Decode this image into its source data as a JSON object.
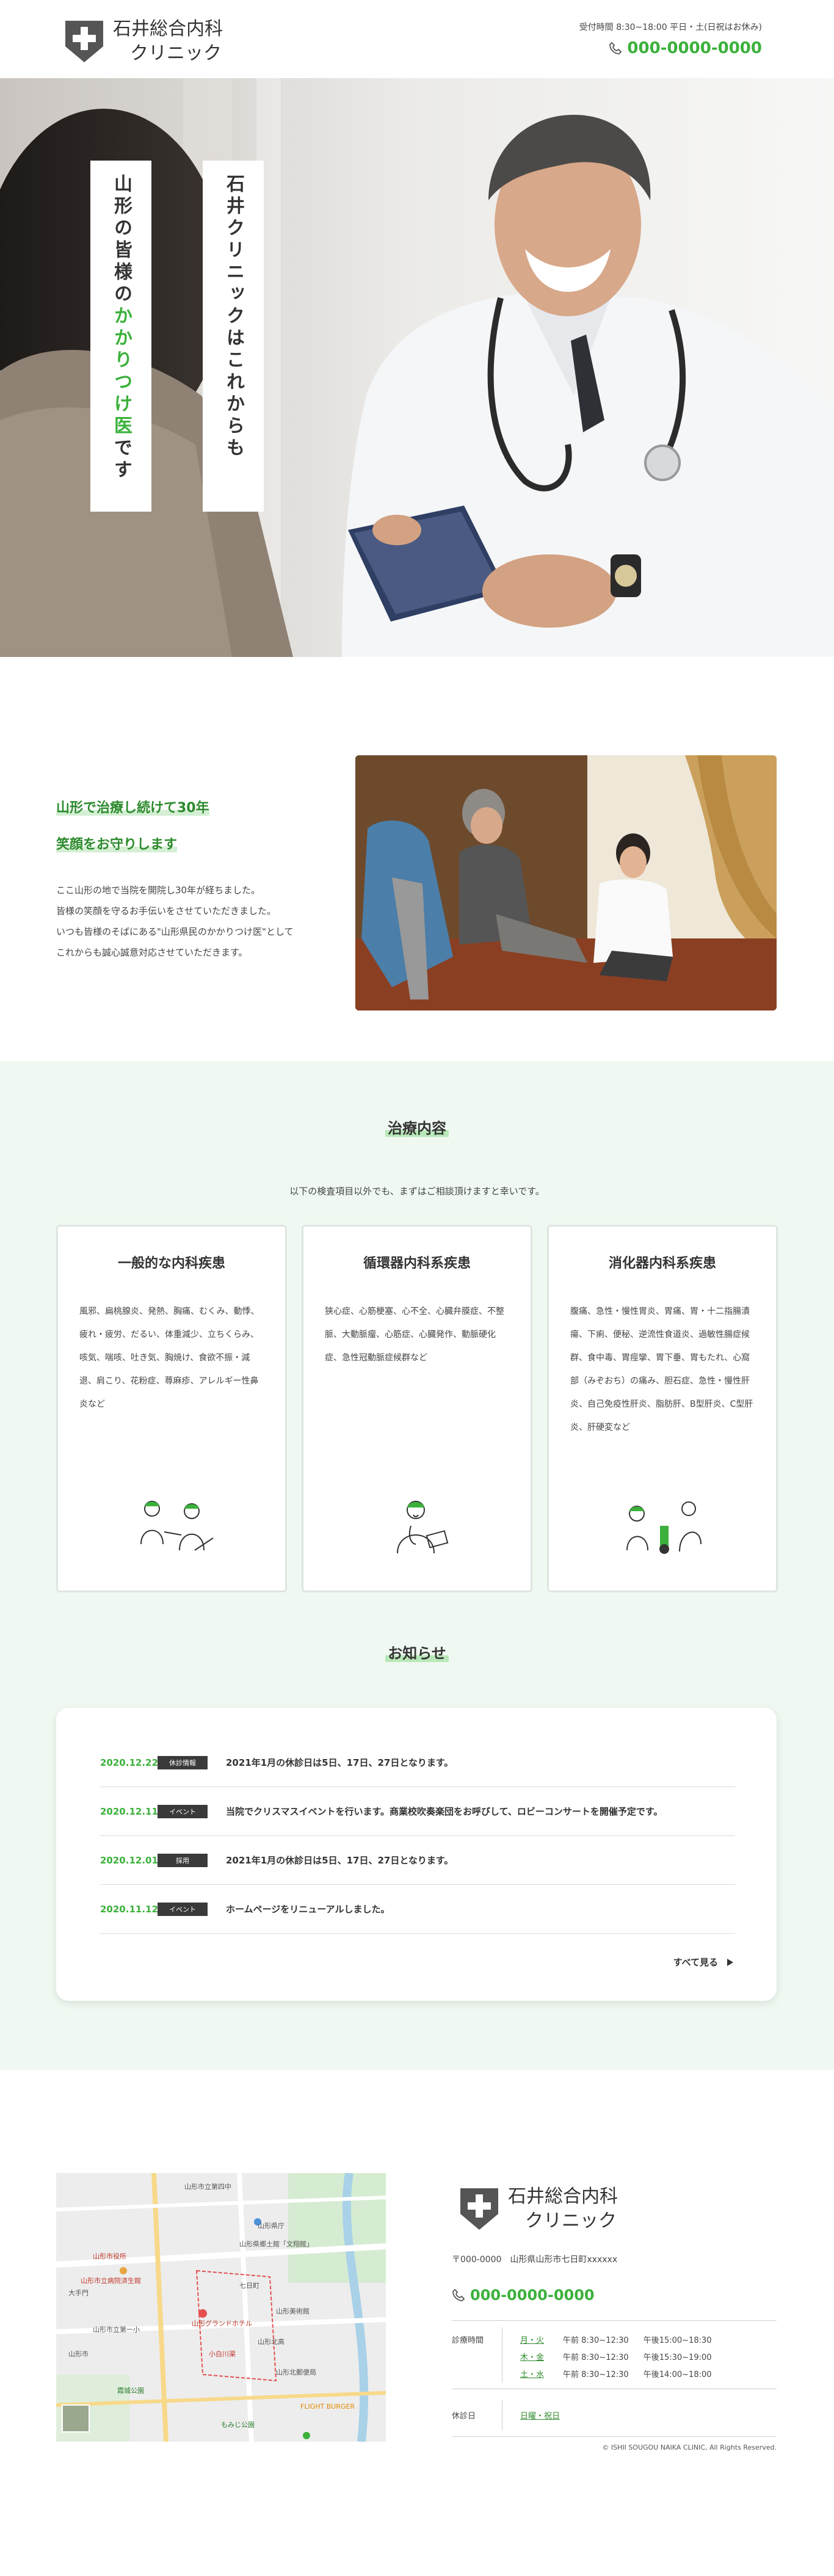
{
  "header": {
    "logo_line1": "石井総合内科",
    "logo_line2": "クリニック",
    "hours": "受付時間 8:30~18:00 平日・土(日祝はお休み)",
    "tel": "000-0000-0000"
  },
  "hero": {
    "vtext_right": "石井クリニックはこれからも",
    "vtext_left_pre": "山形の皆様の",
    "vtext_left_hl": "かかりつけ医",
    "vtext_left_post": "です"
  },
  "intro": {
    "title1": "山形で治療し続けて30年",
    "title2": "笑顔をお守りします",
    "lines": [
      "ここ山形の地で当院を開院し30年が経ちました。",
      "皆様の笑顔を守るお手伝いをさせていただきました。",
      "いつも皆様のそばにある\"山形県民のかかりつけ医\"として",
      "これからも誠心誠意対応させていただきます。"
    ]
  },
  "services": {
    "title": "治療内容",
    "subtitle": "以下の検査項目以外でも、まずはご相談頂けますと幸いです。",
    "cards": [
      {
        "title": "一般的な内科疾患",
        "text": "風邪、扁桃腺炎、発熱、胸痛、むくみ、動悸、疲れ・疲労、だるい、体重減少、立ちくらみ、咳気、喘咳、吐き気、胸焼け、食欲不振・減退、肩こり、花粉症、蕁麻疹、アレルギー性鼻炎など"
      },
      {
        "title": "循環器内科系疾患",
        "text": "狭心症、心筋梗塞、心不全、心臓弁膜症、不整脈、大動脈瘤、心筋症、心臓発作、動脈硬化症、急性冠動脈症候群など"
      },
      {
        "title": "消化器内科系疾患",
        "text": "腹痛、急性・慢性胃炎、胃痛、胃・十二指腸潰瘍、下痢、便秘、逆流性食道炎、過敏性腸症候群、食中毒、胃痙攣、胃下垂、胃もたれ、心窩部（みぞおち）の痛み、胆石症、急性・慢性肝炎、自己免疫性肝炎、脂肪肝、B型肝炎、C型肝炎、肝硬変など"
      }
    ]
  },
  "news": {
    "title": "お知らせ",
    "items": [
      {
        "date": "2020.12.22",
        "tag": "休診情報",
        "text": "2021年1月の休診日は5日、17日、27日となります。"
      },
      {
        "date": "2020.12.11",
        "tag": "イベント",
        "text": "当院でクリスマスイベントを行います。商業校吹奏楽団をお呼びして、ロビーコンサートを開催予定です。"
      },
      {
        "date": "2020.12.01",
        "tag": "採用",
        "text": "2021年1月の休診日は5日、17日、27日となります。"
      },
      {
        "date": "2020.11.12",
        "tag": "イベント",
        "text": "ホームページをリニューアルしました。"
      }
    ],
    "more": "すべて見る"
  },
  "footer": {
    "logo_line1": "石井総合内科",
    "logo_line2": "クリニック",
    "address": "〒000-0000　山形県山形市七日町xxxxxx",
    "tel": "000-0000-0000",
    "hours_label": "診療時間",
    "schedule": [
      {
        "day": "月・火",
        "am": "午前 8:30~12:30",
        "pm": "午後15:00~18:30"
      },
      {
        "day": "木・金",
        "am": "午前 8:30~12:30",
        "pm": "午後15:30~19:00"
      },
      {
        "day": "土・水",
        "am": "午前 8:30~12:30",
        "pm": "午後14:00~18:00"
      }
    ],
    "holiday_label": "休診日",
    "holiday": "日曜・祝日",
    "copyright": "© ISHII SOUGOU NAIKA CLINIC, All Rights Reserved."
  },
  "map": {
    "labels": [
      "山形市立第四中",
      "山形県庁",
      "山形市役所",
      "山形県郷土館「文翔館」",
      "七日町",
      "大手門",
      "山形グランドホテル",
      "山形市立病院済生館",
      "山形美術館",
      "山形市立第一小",
      "山形北高",
      "山形市",
      "霞城公園",
      "FLIGHT BURGER",
      "もみじ公園",
      "山形北郵便局",
      "小白川渠"
    ]
  },
  "colors": {
    "accent": "#3bb13b",
    "bg_light": "#f0f9f1",
    "tag_bg": "#3a3a3a"
  },
  "icons": [
    "shield-cross-icon",
    "phone-icon",
    "arrow-right-icon"
  ]
}
